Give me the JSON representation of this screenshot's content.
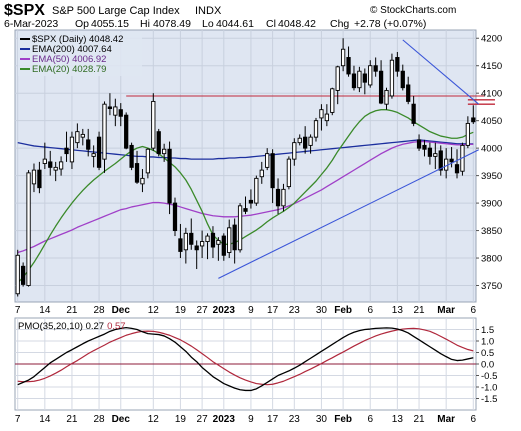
{
  "header": {
    "symbol": "$SPX",
    "name": "S&P 500 Large Cap Index",
    "exchange": "INDX",
    "date": "6-Mar-2023",
    "open_label": "Op",
    "open": "4055.15",
    "high_label": "Hi",
    "high": "4078.49",
    "low_label": "Lo",
    "low": "4044.61",
    "close_label": "Cl",
    "close": "4048.42",
    "change_label": "Chg",
    "change": "+2.78 (+0.07%)",
    "copyright": "© StockCharts.com"
  },
  "colors": {
    "background": "#ffffff",
    "panel_bg_top": "#dfe6f2",
    "grid": "#c8d0de",
    "candle": "#000000",
    "ema200": "#1c2f9e",
    "ema50": "#a040c8",
    "ema20": "#3a8a2a",
    "trendline": "#3b56d8",
    "resistance": "#c0283a",
    "pmo": "#000000",
    "pmo_signal": "#b0283c",
    "zero_line": "#8e1b3a"
  },
  "chart_data": [
    {
      "type": "candlestick",
      "title": "$SPX (Daily) 4048.42",
      "ylim": [
        3720,
        4215
      ],
      "y_ticks": [
        3750,
        3800,
        3850,
        3900,
        3950,
        4000,
        4050,
        4100,
        4150,
        4200
      ],
      "x_tick_labels": [
        "7",
        "14",
        "21",
        "28",
        "Dec",
        "12",
        "19",
        "27",
        "2023",
        "9",
        "17",
        "23",
        "30",
        "Feb",
        "6",
        "13",
        "21",
        "Mar",
        "6"
      ],
      "x_tick_index": [
        0,
        5,
        10,
        15,
        19,
        25,
        30,
        34,
        38,
        43,
        47,
        51,
        56,
        60,
        65,
        70,
        74,
        79,
        84
      ],
      "legend": [
        {
          "name": "$SPX (Daily) 4048.42",
          "color": "#000000"
        },
        {
          "name": "EMA(200) 4007.64",
          "color": "#1c2f9e"
        },
        {
          "name": "EMA(50) 4006.92",
          "color": "#a040c8"
        },
        {
          "name": "EMA(20) 4028.79",
          "color": "#3a8a2a"
        }
      ],
      "candles": {
        "ohlc": [
          [
            3735,
            3815,
            3730,
            3805
          ],
          [
            3785,
            3792,
            3748,
            3752
          ],
          [
            3750,
            3960,
            3748,
            3955
          ],
          [
            3935,
            3972,
            3920,
            3960
          ],
          [
            3960,
            3975,
            3918,
            3928
          ],
          [
            3972,
            4010,
            3962,
            3980
          ],
          [
            3975,
            3995,
            3950,
            3965
          ],
          [
            3960,
            3975,
            3940,
            3965
          ],
          [
            3962,
            3985,
            3950,
            3975
          ],
          [
            4000,
            4030,
            3975,
            3990
          ],
          [
            3975,
            4030,
            3962,
            4020
          ],
          [
            4010,
            4045,
            4000,
            4030
          ],
          [
            4020,
            4035,
            4005,
            4025
          ],
          [
            4015,
            4035,
            3985,
            3998
          ],
          [
            3985,
            4005,
            3965,
            3990
          ],
          [
            4020,
            4030,
            3960,
            3965
          ],
          [
            3980,
            4085,
            3955,
            4080
          ],
          [
            4075,
            4100,
            4060,
            4072
          ],
          [
            4060,
            4090,
            4040,
            4075
          ],
          [
            4070,
            4082,
            4040,
            4058
          ],
          [
            4060,
            4065,
            3998,
            4000
          ],
          [
            4005,
            4010,
            3960,
            3965
          ],
          [
            3972,
            3995,
            3935,
            3938
          ],
          [
            3935,
            3962,
            3920,
            3945
          ],
          [
            3955,
            4000,
            3945,
            3998
          ],
          [
            4000,
            4100,
            3995,
            4085
          ],
          [
            4030,
            4035,
            3985,
            3990
          ],
          [
            3990,
            4008,
            3975,
            3998
          ],
          [
            3998,
            4012,
            3880,
            3900
          ],
          [
            3900,
            3910,
            3840,
            3850
          ],
          [
            3835,
            3862,
            3800,
            3812
          ],
          [
            3815,
            3855,
            3790,
            3845
          ],
          [
            3845,
            3872,
            3815,
            3825
          ],
          [
            3822,
            3832,
            3780,
            3815
          ],
          [
            3822,
            3850,
            3800,
            3830
          ],
          [
            3830,
            3845,
            3798,
            3840
          ],
          [
            3845,
            3858,
            3800,
            3820
          ],
          [
            3825,
            3838,
            3795,
            3832
          ],
          [
            3840,
            3845,
            3795,
            3805
          ],
          [
            3810,
            3870,
            3800,
            3855
          ],
          [
            3860,
            3872,
            3790,
            3815
          ],
          [
            3815,
            3900,
            3810,
            3895
          ],
          [
            3890,
            3912,
            3880,
            3885
          ],
          [
            3905,
            3925,
            3890,
            3900
          ],
          [
            3900,
            3950,
            3895,
            3945
          ],
          [
            3948,
            3975,
            3935,
            3960
          ],
          [
            3965,
            4000,
            3960,
            3990
          ],
          [
            3990,
            3998,
            3900,
            3928
          ],
          [
            3925,
            3945,
            3880,
            3895
          ],
          [
            3895,
            3935,
            3885,
            3925
          ],
          [
            3930,
            3985,
            3925,
            3980
          ],
          [
            3980,
            4018,
            3968,
            4010
          ],
          [
            4010,
            4025,
            4005,
            4018
          ],
          [
            4020,
            4040,
            3990,
            4000
          ],
          [
            4005,
            4025,
            3990,
            4020
          ],
          [
            4020,
            4055,
            4012,
            4050
          ],
          [
            4055,
            4080,
            4032,
            4070
          ],
          [
            4050,
            4080,
            4040,
            4062
          ],
          [
            4065,
            4110,
            4060,
            4108
          ],
          [
            4105,
            4150,
            4080,
            4148
          ],
          [
            4150,
            4200,
            4140,
            4180
          ],
          [
            4165,
            4185,
            4130,
            4135
          ],
          [
            4135,
            4150,
            4105,
            4110
          ],
          [
            4110,
            4148,
            4102,
            4140
          ],
          [
            4135,
            4145,
            4098,
            4120
          ],
          [
            4115,
            4160,
            4110,
            4150
          ],
          [
            4150,
            4165,
            4130,
            4140
          ],
          [
            4140,
            4160,
            4080,
            4082
          ],
          [
            4080,
            4110,
            4070,
            4105
          ],
          [
            4095,
            4172,
            4090,
            4160
          ],
          [
            4165,
            4175,
            4130,
            4140
          ],
          [
            4140,
            4152,
            4105,
            4110
          ],
          [
            4115,
            4130,
            4080,
            4085
          ],
          [
            4080,
            4095,
            4040,
            4045
          ],
          [
            4015,
            4025,
            3995,
            4000
          ],
          [
            4005,
            4015,
            3985,
            3998
          ],
          [
            4000,
            4010,
            3970,
            3985
          ],
          [
            3985,
            4010,
            3962,
            3990
          ],
          [
            3995,
            4005,
            3950,
            3960
          ],
          [
            3960,
            4000,
            3945,
            3980
          ],
          [
            3980,
            4002,
            3965,
            3975
          ],
          [
            3970,
            3998,
            3945,
            3955
          ],
          [
            3958,
            4010,
            3950,
            4005
          ],
          [
            4005,
            4058,
            4000,
            4045
          ],
          [
            4055,
            4078,
            4044,
            4048
          ]
        ]
      },
      "lines": {
        "ema200": [
          4010,
          4008,
          4006,
          4004,
          4003,
          4002,
          4001,
          4000,
          3999,
          3998,
          3997,
          3996,
          3995,
          3994,
          3993,
          3992,
          3991,
          3990,
          3989,
          3988,
          3987,
          3986,
          3985,
          3985,
          3984,
          3984,
          3983,
          3983,
          3982,
          3982,
          3981,
          3981,
          3980,
          3980,
          3980,
          3980,
          3980,
          3981,
          3981,
          3982,
          3982,
          3983,
          3983,
          3984,
          3985,
          3986,
          3987,
          3988,
          3989,
          3990,
          3991,
          3992,
          3993,
          3994,
          3995,
          3996,
          3997,
          3998,
          3999,
          4000,
          4001,
          4002,
          4003,
          4004,
          4005,
          4006,
          4007,
          4008,
          4009,
          4010,
          4011,
          4012,
          4013,
          4014,
          4015,
          4014,
          4013,
          4012,
          4011,
          4010,
          4009,
          4008,
          4008,
          4007.64,
          4007.64
        ],
        "ema50": [
          3810,
          3813,
          3817,
          3821,
          3826,
          3831,
          3835,
          3839,
          3843,
          3847,
          3851,
          3856,
          3860,
          3864,
          3868,
          3872,
          3876,
          3880,
          3884,
          3888,
          3890,
          3893,
          3895,
          3897,
          3899,
          3901,
          3901,
          3900,
          3898,
          3896,
          3893,
          3890,
          3887,
          3884,
          3881,
          3879,
          3877,
          3876,
          3875,
          3875,
          3875,
          3876,
          3877,
          3878,
          3880,
          3882,
          3884,
          3886,
          3888,
          3891,
          3895,
          3899,
          3904,
          3909,
          3914,
          3919,
          3924,
          3930,
          3936,
          3942,
          3948,
          3954,
          3960,
          3966,
          3972,
          3978,
          3984,
          3990,
          3995,
          4000,
          4004,
          4007,
          4009,
          4011,
          4012,
          4012,
          4011,
          4010,
          4009,
          4008,
          4007,
          4006,
          4006,
          4006.92,
          4006.92
        ],
        "ema20": [
          3755,
          3765,
          3778,
          3792,
          3808,
          3825,
          3842,
          3858,
          3873,
          3887,
          3900,
          3912,
          3923,
          3933,
          3942,
          3950,
          3958,
          3965,
          3972,
          3980,
          3988,
          3995,
          4000,
          4003,
          4000,
          3996,
          3990,
          3982,
          3974,
          3966,
          3955,
          3942,
          3925,
          3905,
          3885,
          3862,
          3842,
          3832,
          3825,
          3825,
          3828,
          3833,
          3839,
          3845,
          3851,
          3858,
          3866,
          3873,
          3879,
          3885,
          3892,
          3900,
          3910,
          3920,
          3930,
          3940,
          3952,
          3964,
          3978,
          3994,
          4008,
          4022,
          4036,
          4048,
          4058,
          4064,
          4068,
          4070,
          4070,
          4068,
          4065,
          4060,
          4055,
          4048,
          4042,
          4036,
          4030,
          4026,
          4022,
          4020,
          4018,
          4018,
          4020,
          4025,
          4028.79
        ],
        "support_trendline": [
          [
            37,
            3763
          ],
          [
            85,
            3997
          ]
        ],
        "resistance_trendline": [
          [
            71,
            4197
          ],
          [
            85,
            4080
          ]
        ],
        "resistance_line": [
          [
            20,
            4095
          ],
          [
            85,
            4095
          ]
        ],
        "resistance_band": [
          [
            83,
            4080
          ],
          [
            88,
            4080
          ],
          [
            83,
            4088
          ],
          [
            88,
            4088
          ]
        ]
      }
    },
    {
      "type": "line",
      "title": "PMO(35,20,10) 0.27, 0.57",
      "ylim": [
        -2.0,
        2.0
      ],
      "y_ticks": [
        -1.5,
        -1.0,
        -0.5,
        0.0,
        0.5,
        1.0,
        1.5
      ],
      "series": [
        {
          "name": "PMO(35,20,10) 0.27",
          "values": [
            -0.9,
            -0.8,
            -0.7,
            -0.55,
            -0.35,
            -0.15,
            0.05,
            0.2,
            0.35,
            0.5,
            0.62,
            0.75,
            0.88,
            1.0,
            1.1,
            1.2,
            1.3,
            1.42,
            1.5,
            1.55,
            1.58,
            1.55,
            1.5,
            1.4,
            1.32,
            1.3,
            1.28,
            1.22,
            1.1,
            0.95,
            0.75,
            0.55,
            0.3,
            0.1,
            -0.15,
            -0.35,
            -0.55,
            -0.7,
            -0.85,
            -0.95,
            -1.05,
            -1.12,
            -1.15,
            -1.15,
            -1.08,
            -0.95,
            -0.8,
            -0.65,
            -0.5,
            -0.4,
            -0.3,
            -0.18,
            -0.05,
            0.1,
            0.25,
            0.4,
            0.55,
            0.7,
            0.85,
            1.0,
            1.15,
            1.28,
            1.38,
            1.45,
            1.5,
            1.52,
            1.55,
            1.56,
            1.57,
            1.56,
            1.52,
            1.45,
            1.35,
            1.2,
            1.05,
            0.9,
            0.75,
            0.6,
            0.45,
            0.32,
            0.2,
            0.15,
            0.17,
            0.22,
            0.27
          ]
        },
        {
          "name": "0.57",
          "values": [
            -0.75,
            -0.77,
            -0.77,
            -0.75,
            -0.7,
            -0.62,
            -0.52,
            -0.4,
            -0.27,
            -0.12,
            0.02,
            0.15,
            0.3,
            0.45,
            0.58,
            0.7,
            0.82,
            0.95,
            1.05,
            1.15,
            1.25,
            1.32,
            1.38,
            1.42,
            1.43,
            1.42,
            1.38,
            1.32,
            1.25,
            1.15,
            1.05,
            0.92,
            0.78,
            0.62,
            0.45,
            0.28,
            0.1,
            -0.05,
            -0.2,
            -0.35,
            -0.48,
            -0.6,
            -0.7,
            -0.78,
            -0.85,
            -0.88,
            -0.9,
            -0.88,
            -0.82,
            -0.75,
            -0.65,
            -0.55,
            -0.45,
            -0.33,
            -0.22,
            -0.1,
            0.02,
            0.15,
            0.27,
            0.4,
            0.52,
            0.65,
            0.78,
            0.9,
            1.02,
            1.12,
            1.22,
            1.3,
            1.37,
            1.43,
            1.48,
            1.52,
            1.54,
            1.55,
            1.53,
            1.48,
            1.42,
            1.32,
            1.2,
            1.08,
            0.95,
            0.82,
            0.72,
            0.63,
            0.57
          ]
        }
      ]
    }
  ]
}
